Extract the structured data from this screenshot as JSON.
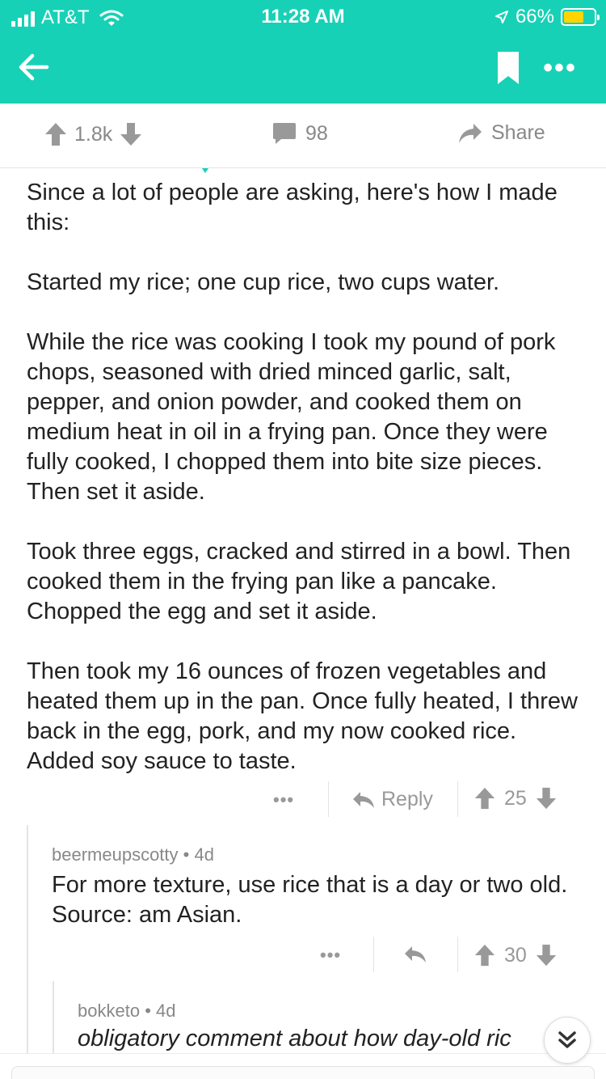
{
  "status_bar": {
    "carrier": "AT&T",
    "time": "11:28 AM",
    "battery_percent": "66%",
    "battery_level": 0.66
  },
  "post_actions": {
    "upvotes": "1.8k",
    "comments": "98",
    "share_label": "Share"
  },
  "main_comment": {
    "paragraphs": [
      "Since a lot of people are asking, here's how I made this:",
      "Started my rice; one cup rice, two cups water.",
      "While the rice was cooking I took my pound of pork chops, seasoned with dried minced garlic, salt, pepper, and onion powder, and cooked them on medium heat in oil in a frying pan. Once they were fully cooked, I chopped them into bite size pieces. Then set it aside.",
      "Took three eggs, cracked and stirred in a bowl. Then cooked them in the frying pan like a pancake. Chopped the egg and set it aside.",
      "Then took my 16 ounces of frozen vegetables and heated them up in the pan. Once fully heated, I threw back in the egg, pork, and my now cooked rice. Added soy sauce to taste."
    ],
    "more_label": "•••",
    "reply_label": "Reply",
    "score": "25"
  },
  "reply_1": {
    "author": "beermeupscotty",
    "age": "4d",
    "text": "For more texture, use rice that is a day or two old. Source: am Asian.",
    "more_label": "•••",
    "score": "30"
  },
  "reply_2": {
    "author": "bokketo",
    "age": "4d",
    "text": "obligatory comment about how day-old ric"
  },
  "colors": {
    "accent": "#17d1b6",
    "battery": "#ffd400",
    "icon_gray": "#999999"
  }
}
